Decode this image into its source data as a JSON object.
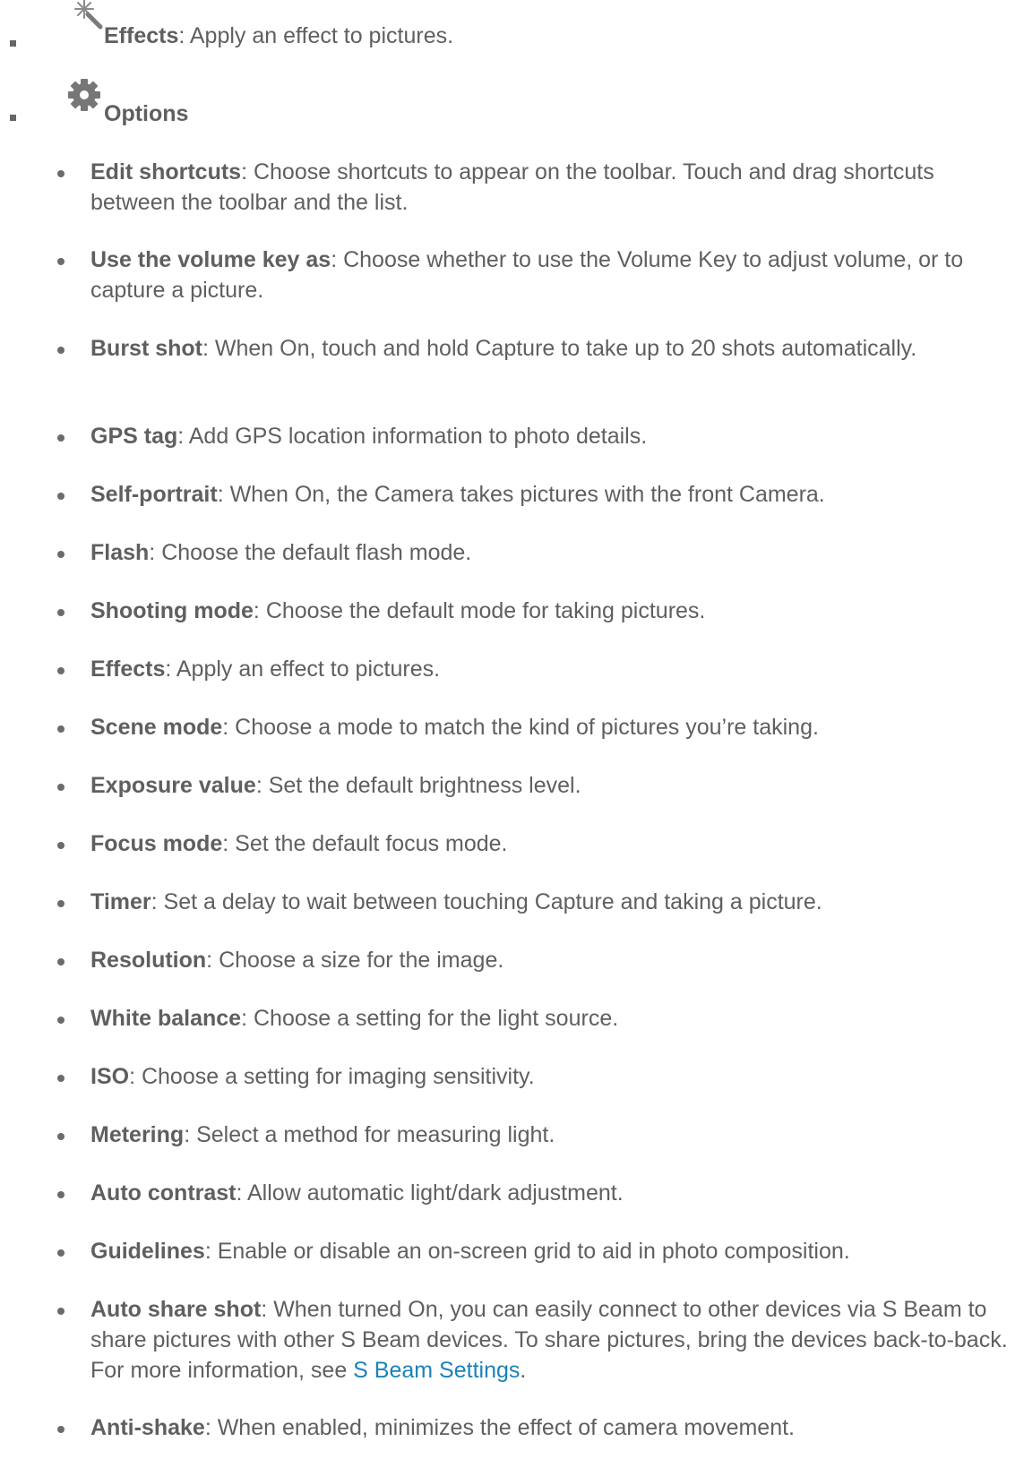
{
  "top_items": [
    {
      "icon": "magic-wand-icon",
      "term": "Effects",
      "desc": ": Apply an effect to pictures."
    },
    {
      "icon": "gear-icon",
      "term": "Options",
      "desc": ""
    }
  ],
  "options": [
    {
      "term": "Edit shortcuts",
      "desc": ": Choose shortcuts to appear on the toolbar. Touch and drag shortcuts between the toolbar and the list."
    },
    {
      "term": "Use the volume key as",
      "desc": ": Choose whether to use the Volume Key to adjust volume, or to capture a picture."
    },
    {
      "term": "Burst shot",
      "desc": ": When On, touch and hold Capture to take up to 20 shots automatically."
    },
    {
      "term": "GPS tag",
      "desc": ": Add GPS location information to photo details."
    },
    {
      "term": "Self-portrait",
      "desc": ": When On, the Camera takes pictures with the front Camera."
    },
    {
      "term": "Flash",
      "desc": ": Choose the default flash mode."
    },
    {
      "term": "Shooting mode",
      "desc": ": Choose the default mode for taking pictures."
    },
    {
      "term": "Effects",
      "desc": ": Apply an effect to pictures."
    },
    {
      "term": "Scene mode",
      "desc": ": Choose a mode to match the kind of pictures you’re taking."
    },
    {
      "term": "Exposure value",
      "desc": ": Set the default brightness level."
    },
    {
      "term": "Focus mode",
      "desc": ": Set the default focus mode."
    },
    {
      "term": "Timer",
      "desc": ": Set a delay to wait between touching Capture and taking a picture."
    },
    {
      "term": "Resolution",
      "desc": ": Choose a size for the image."
    },
    {
      "term": "White balance",
      "desc": ": Choose a setting for the light source."
    },
    {
      "term": "ISO",
      "desc": ": Choose a setting for imaging sensitivity."
    },
    {
      "term": "Metering",
      "desc": ": Select a method for measuring light."
    },
    {
      "term": "Auto contrast",
      "desc": ": Allow automatic light/dark adjustment."
    },
    {
      "term": "Guidelines",
      "desc": ": Enable or disable an on-screen grid to aid in photo composition."
    },
    {
      "term": "Auto share shot",
      "desc": ": When turned On, you can easily connect to other devices via S Beam to share pictures with other S Beam devices. To share pictures, bring the devices back-to-back. For more information, see ",
      "link": "S Beam Settings",
      "after": "."
    },
    {
      "term": "Anti-shake",
      "desc": ": When enabled, minimizes the effect of camera movement."
    }
  ],
  "colors": {
    "text": "#5f5f5f",
    "link": "#1a82b8",
    "icon": "#777777"
  }
}
